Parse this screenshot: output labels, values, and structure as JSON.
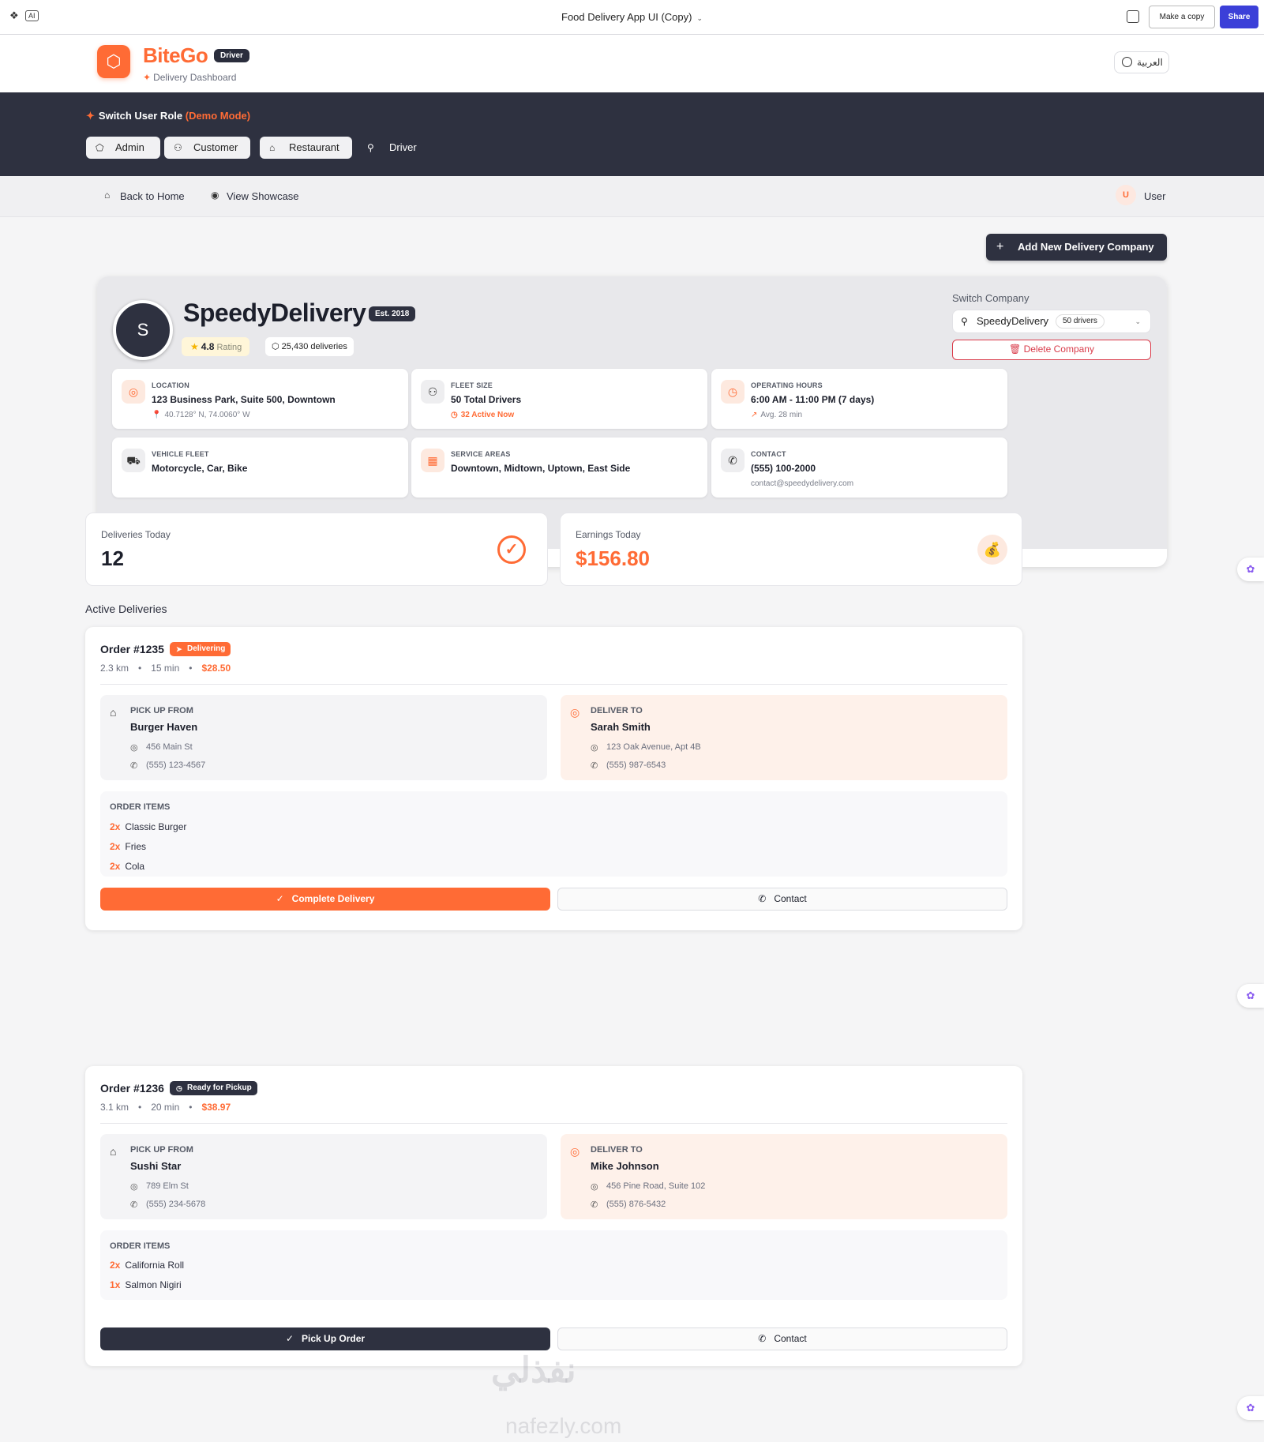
{
  "editor": {
    "title": "Food Delivery App UI (Copy)",
    "ai_label": "AI",
    "make_copy": "Make a copy",
    "share": "Share"
  },
  "header": {
    "brand": "BiteGo",
    "role_badge": "Driver",
    "subtitle": "Delivery Dashboard",
    "language": "العربية"
  },
  "role_switcher": {
    "title": "Switch User Role",
    "mode": "(Demo Mode)",
    "roles": [
      "Admin",
      "Customer",
      "Restaurant",
      "Driver"
    ]
  },
  "nav": {
    "back_home": "Back to Home",
    "view_showcase": "View Showcase",
    "user_initial": "U",
    "user_name": "User"
  },
  "actions": {
    "add_company": "Add New Delivery Company"
  },
  "company": {
    "initial": "S",
    "name": "SpeedyDelivery",
    "established": "Est. 2018",
    "rating": "4.8",
    "rating_label": "Rating",
    "deliveries": "25,430 deliveries",
    "switch_label": "Switch Company",
    "selected": "SpeedyDelivery",
    "drivers": "50 drivers",
    "delete": "Delete Company",
    "info": {
      "location": {
        "label": "LOCATION",
        "value": "123 Business Park, Suite 500, Downtown",
        "sub": "40.7128° N, 74.0060° W"
      },
      "fleet_size": {
        "label": "FLEET SIZE",
        "value": "50 Total Drivers",
        "sub": "32 Active Now"
      },
      "hours": {
        "label": "OPERATING HOURS",
        "value": "6:00 AM - 11:00 PM (7 days)",
        "sub": "Avg. 28 min"
      },
      "vehicles": {
        "label": "VEHICLE FLEET",
        "value": "Motorcycle, Car, Bike"
      },
      "areas": {
        "label": "SERVICE AREAS",
        "value": "Downtown, Midtown, Uptown, East Side"
      },
      "contact": {
        "label": "CONTACT",
        "value": "(555) 100-2000",
        "sub": "contact@speedydelivery.com"
      }
    }
  },
  "stats": {
    "deliveries_label": "Deliveries Today",
    "deliveries_value": "12",
    "earnings_label": "Earnings Today",
    "earnings_value": "$156.80"
  },
  "active_title": "Active Deliveries",
  "orders": [
    {
      "title": "Order #1235",
      "status": "Delivering",
      "distance": "2.3 km",
      "time": "15 min",
      "price": "$28.50",
      "pickup_label": "PICK UP FROM",
      "pickup_name": "Burger Haven",
      "pickup_address": "456 Main St",
      "pickup_phone": "(555) 123-4567",
      "deliver_label": "DELIVER TO",
      "deliver_name": "Sarah Smith",
      "deliver_address": "123 Oak Avenue, Apt 4B",
      "deliver_phone": "(555) 987-6543",
      "items_label": "ORDER ITEMS",
      "items": [
        {
          "qty": "2x",
          "name": "Classic Burger"
        },
        {
          "qty": "2x",
          "name": "Fries"
        },
        {
          "qty": "2x",
          "name": "Cola"
        }
      ],
      "action": "Complete Delivery",
      "contact": "Contact"
    },
    {
      "title": "Order #1236",
      "status": "Ready for Pickup",
      "distance": "3.1 km",
      "time": "20 min",
      "price": "$38.97",
      "pickup_label": "PICK UP FROM",
      "pickup_name": "Sushi Star",
      "pickup_address": "789 Elm St",
      "pickup_phone": "(555) 234-5678",
      "deliver_label": "DELIVER TO",
      "deliver_name": "Mike Johnson",
      "deliver_address": "456 Pine Road, Suite 102",
      "deliver_phone": "(555) 876-5432",
      "items_label": "ORDER ITEMS",
      "items": [
        {
          "qty": "2x",
          "name": "California Roll"
        },
        {
          "qty": "1x",
          "name": "Salmon Nigiri"
        }
      ],
      "action": "Pick Up Order",
      "contact": "Contact"
    }
  ],
  "watermark": {
    "arabic": "نفذلي",
    "latin": "nafezly.com"
  },
  "colors": {
    "accent": "#ff6b35",
    "dark": "#2e3140",
    "share": "#3b3fd8",
    "danger": "#d93b4a"
  }
}
